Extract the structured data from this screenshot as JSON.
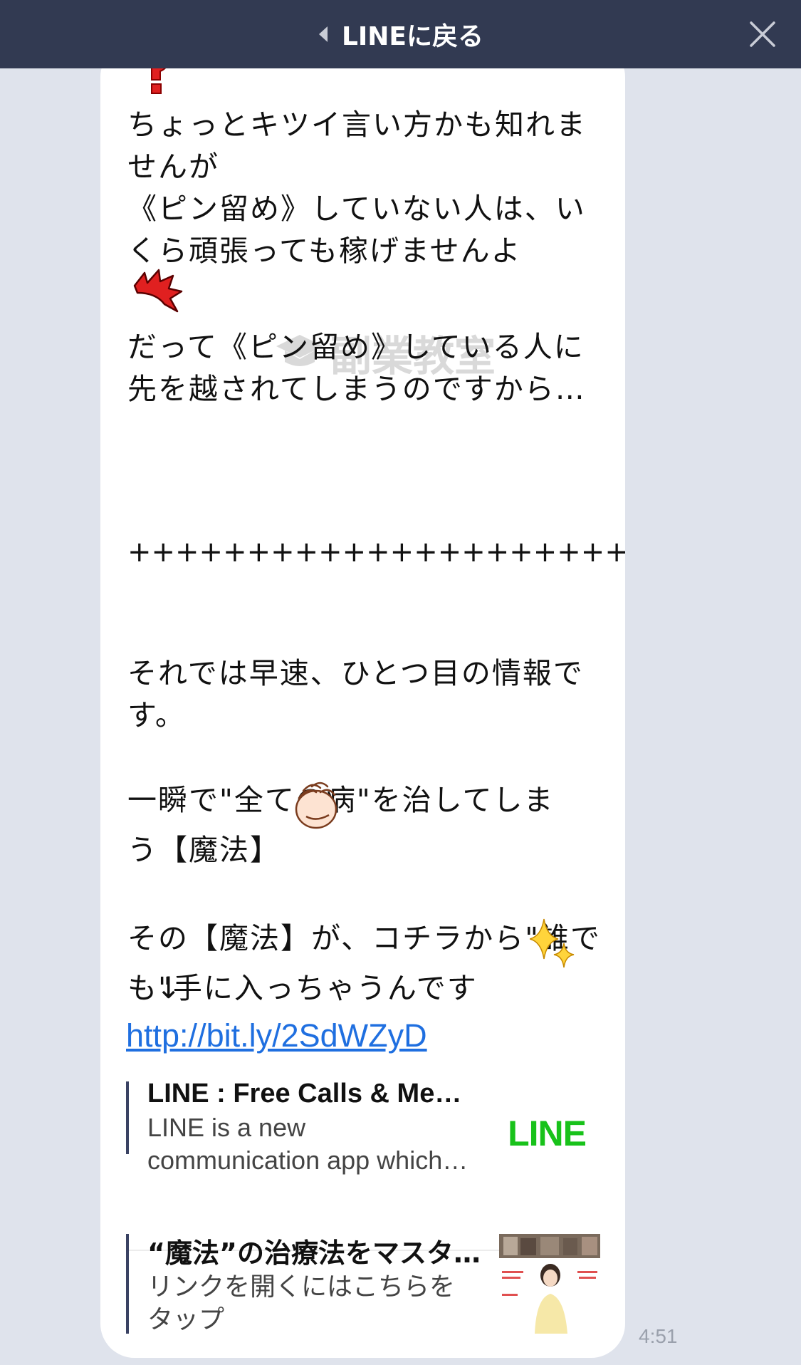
{
  "header": {
    "back_label": "LINEに戻る"
  },
  "message": {
    "line1": "ちょっとキツイ言い方かも知れませんが",
    "line2": "《ピン留め》していない人は、いくら頑張っても稼げませんよ",
    "line3": "だって《ピン留め》している人に先を越されてしまうのですから…",
    "plus_line": "++++++++++++++++++++++++++++++",
    "line4": "それでは早速、ひとつ目の情報です。",
    "line5": "一瞬で\"全ての病\"を治してしまう【魔法】",
    "line6": "その【魔法】が、コチラから\"誰でも\"手に入っちゃうんです",
    "arrow": "↓",
    "link": "http://bit.ly/2SdWZyD",
    "watermark": "副業教室",
    "timestamp": "4:51"
  },
  "preview1": {
    "title": "LINE : Free Calls & Messages",
    "desc_line1": "LINE is a new",
    "desc_line2": "communication app which allows you",
    "logo": "LINE"
  },
  "preview2": {
    "title": "“魔法”の治療法をマスターしよう",
    "desc_line1": "リンクを開くにはこちらを",
    "desc_line2": "タップ"
  },
  "icons": {
    "back": "chevron-left-icon",
    "close": "close-icon",
    "question": "red-question-icon",
    "anger": "anger-icon",
    "clap": "clapping-hands-icon",
    "sparkle": "sparkles-icon"
  },
  "colors": {
    "header_bg": "#323a52",
    "page_bg": "#dfe3ec",
    "link": "#1f6fe0",
    "line_green": "#18c21a"
  }
}
